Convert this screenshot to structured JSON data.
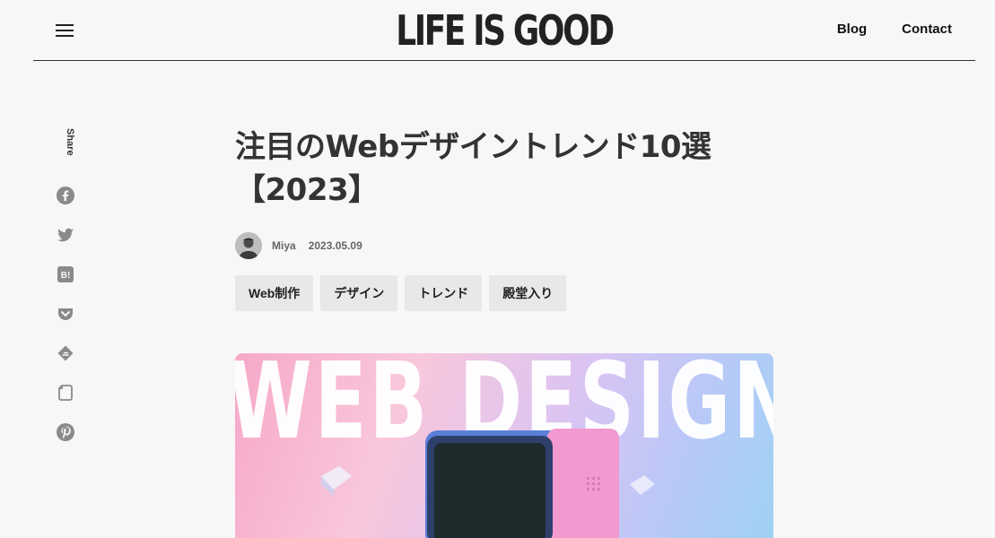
{
  "header": {
    "logo": "LIFE IS GOOD",
    "nav": [
      {
        "label": "Blog"
      },
      {
        "label": "Contact"
      }
    ]
  },
  "share": {
    "label": "Share",
    "icons": [
      "facebook-icon",
      "twitter-icon",
      "hatena-bookmark-icon",
      "pocket-icon",
      "feedly-icon",
      "note-icon",
      "pinterest-icon"
    ]
  },
  "article": {
    "title_line1": "注目のWebデザイントレンド10選",
    "title_line2": "【2023】",
    "author": "Miya",
    "date": "2023.05.09",
    "tags": [
      "Web制作",
      "デザイン",
      "トレンド",
      "殿堂入り"
    ],
    "hero_text": "WEB DESIGN"
  },
  "colors": {
    "background": "#f7f7f7",
    "text": "#333333",
    "tag_background": "#e8e8e8",
    "icon": "#8a8a8a"
  }
}
